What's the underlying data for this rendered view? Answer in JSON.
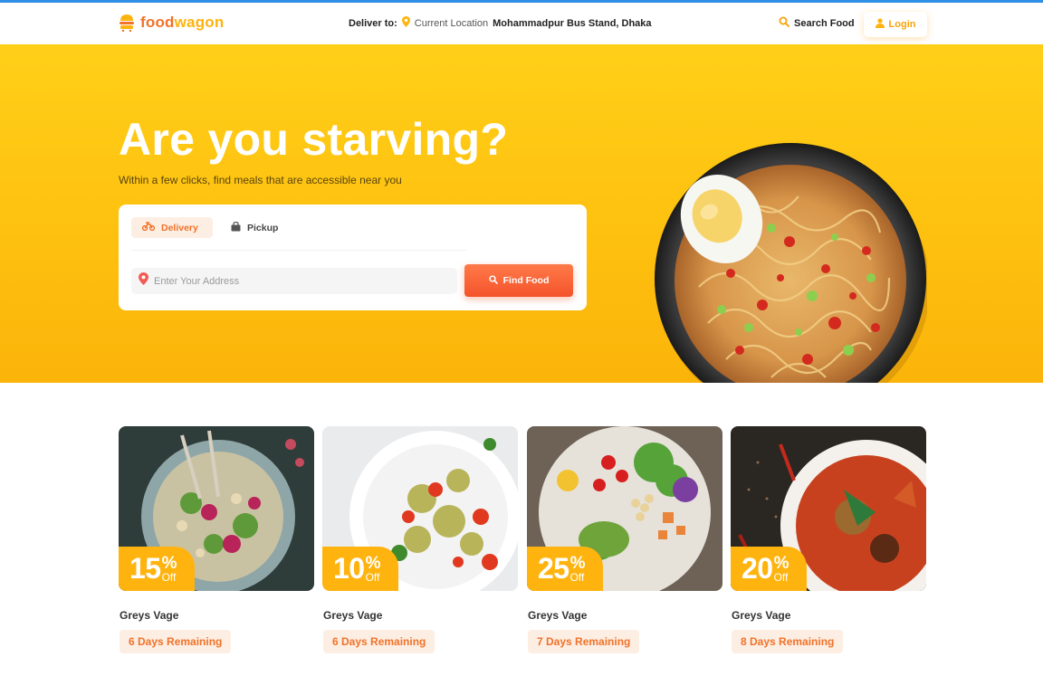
{
  "brand": {
    "name_part1": "food",
    "name_part2": "wagon",
    "color_primary": "#f17228",
    "color_secondary": "#ffb30e"
  },
  "header": {
    "deliver_label": "Deliver to:",
    "current_location_label": "Current Location",
    "location_value": "Mohammadpur Bus Stand, Dhaka",
    "search_label": "Search Food",
    "login_label": "Login"
  },
  "hero": {
    "title": "Are you starving?",
    "subtitle": "Within a few clicks, find meals that are accessible near you",
    "tabs": [
      {
        "label": "Delivery",
        "icon": "motorbike-icon",
        "active": true
      },
      {
        "label": "Pickup",
        "icon": "shopping-bag-icon",
        "active": false
      }
    ],
    "address_placeholder": "Enter Your Address",
    "find_button_label": "Find Food"
  },
  "deals": [
    {
      "percent": "15",
      "pct_sign": "%",
      "off_label": "Off",
      "name": "Greys Vage",
      "remaining": "6 Days Remaining"
    },
    {
      "percent": "10",
      "pct_sign": "%",
      "off_label": "Off",
      "name": "Greys Vage",
      "remaining": "6 Days Remaining"
    },
    {
      "percent": "25",
      "pct_sign": "%",
      "off_label": "Off",
      "name": "Greys Vage",
      "remaining": "7 Days Remaining"
    },
    {
      "percent": "20",
      "pct_sign": "%",
      "off_label": "Off",
      "name": "Greys Vage",
      "remaining": "8 Days Remaining"
    }
  ]
}
